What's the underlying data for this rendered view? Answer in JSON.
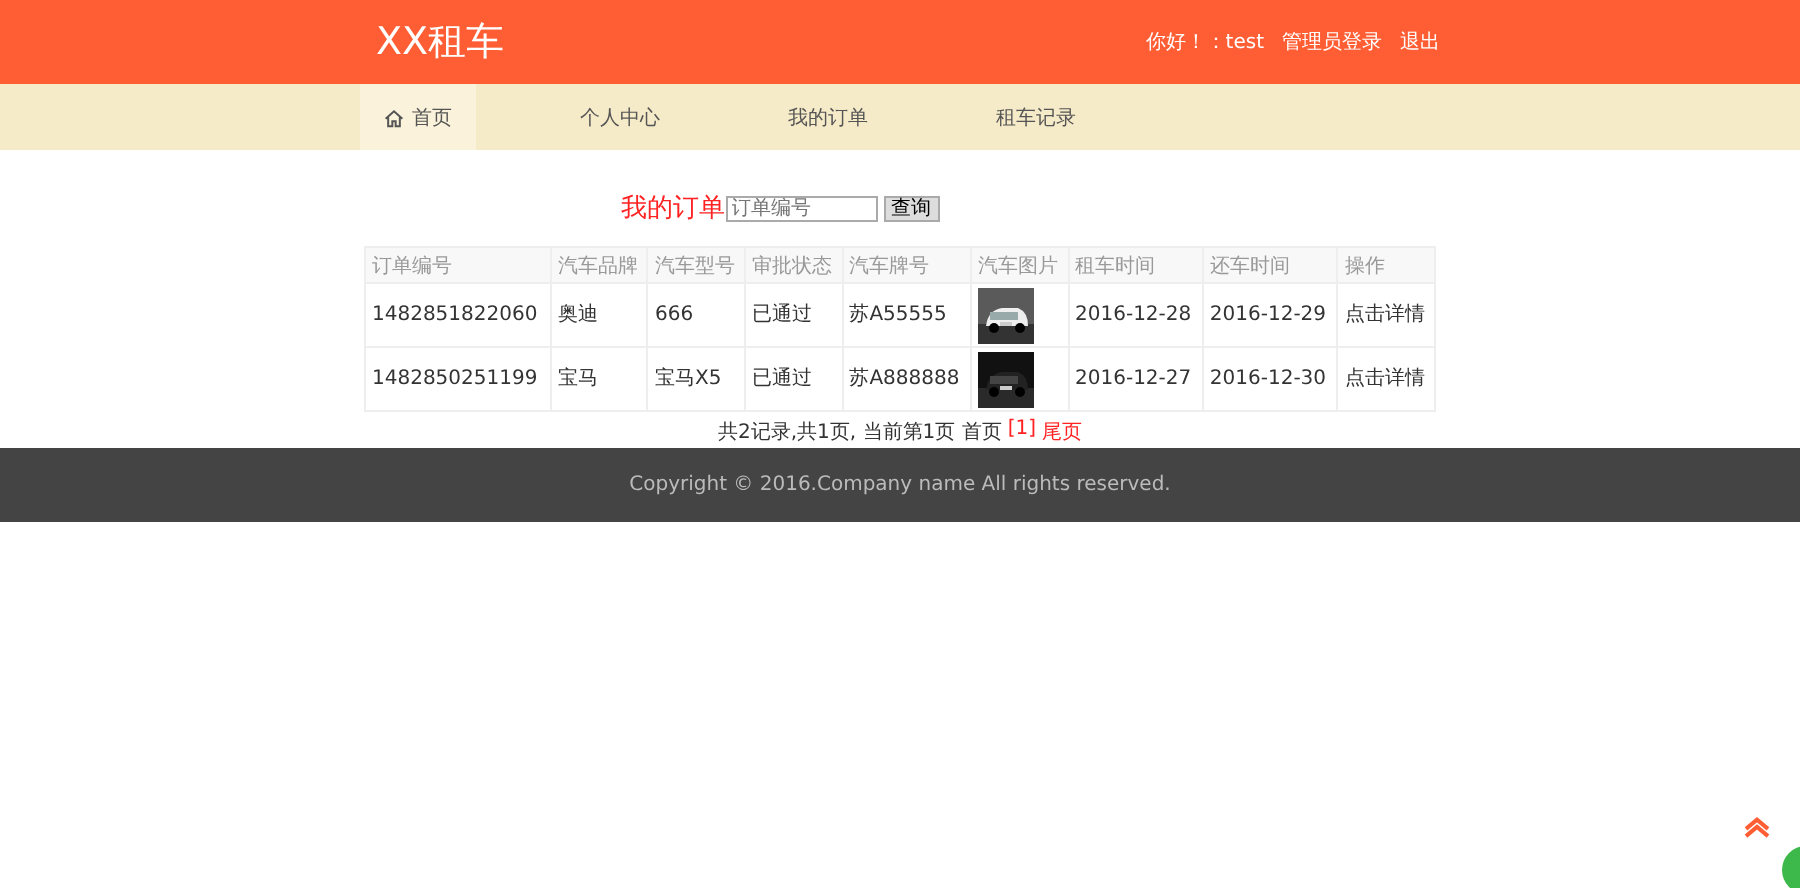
{
  "header": {
    "logo": "XX租车",
    "links": [
      "你好！：test",
      "管理员登录",
      "退出"
    ]
  },
  "nav": [
    {
      "label": "首页",
      "selected": true,
      "icon": true
    },
    {
      "label": "个人中心",
      "selected": false,
      "icon": false
    },
    {
      "label": "我的订单",
      "selected": false,
      "icon": false
    },
    {
      "label": "租车记录",
      "selected": false,
      "icon": false
    }
  ],
  "search": {
    "title": "我的订单",
    "placeholder": "订单编号",
    "button": "查询"
  },
  "table": {
    "columns": [
      "订单编号",
      "汽车品牌",
      "汽车型号",
      "审批状态",
      "汽车牌号",
      "汽车图片",
      "租车时间",
      "还车时间",
      "操作"
    ],
    "rows": [
      {
        "cells": [
          "1482851822060",
          "奥迪",
          "666",
          "已通过",
          "苏A55555"
        ],
        "photo": {
          "kind": "picture"
        },
        "dates": [
          "2016-12-28",
          "2016-12-29"
        ],
        "action": "点击详情"
      },
      {
        "cells": [
          "1482850251199",
          "宝马",
          "宝马X5",
          "已通过",
          "苏A888888"
        ],
        "photo": {
          "kind": "picture"
        },
        "dates": [
          "2016-12-27",
          "2016-12-30"
        ],
        "action": "点击详情"
      }
    ]
  },
  "pagination": {
    "summary": "共2记录,共1页, 当前第1页 首页",
    "links": [
      "[1]",
      "尾页"
    ]
  },
  "footer": "Copyright © 2016.Company name All rights reserved."
}
